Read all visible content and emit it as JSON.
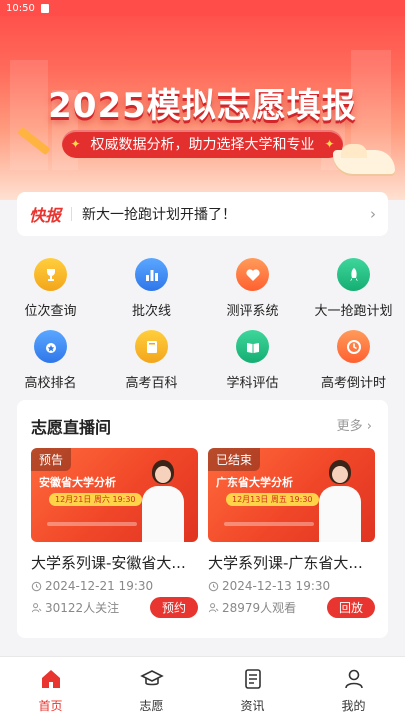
{
  "status_bar": {
    "time": "10:50"
  },
  "hero": {
    "title": "2025模拟志愿填报",
    "subtitle": "权威数据分析，助力选择大学和专业",
    "accent": "#ff4a48"
  },
  "news": {
    "tag": "快报",
    "text": "新大一抢跑计划开播了！"
  },
  "grid": [
    {
      "label": "位次查询",
      "icon": "trophy-icon",
      "color": "#f3a51a"
    },
    {
      "label": "批次线",
      "icon": "bar-chart-icon",
      "color": "#2f77ea"
    },
    {
      "label": "测评系统",
      "icon": "heart-icon",
      "color": "#ff6030"
    },
    {
      "label": "大一抢跑计划",
      "icon": "rocket-icon",
      "color": "#15ae72"
    },
    {
      "label": "高校排名",
      "icon": "medal-star-icon",
      "color": "#2f77ea"
    },
    {
      "label": "高考百科",
      "icon": "book-icon",
      "color": "#f3a51a"
    },
    {
      "label": "学科评估",
      "icon": "open-book-icon",
      "color": "#15ae72"
    },
    {
      "label": "高考倒计时",
      "icon": "clock-icon",
      "color": "#ff6030"
    }
  ],
  "live": {
    "title": "志愿直播间",
    "more": "更多",
    "cards": [
      {
        "badge": "预告",
        "thumb_title": "安徽省大学分析",
        "thumb_date": "12月21日 周六 19:30",
        "name": "大学系列课-安徽省大...",
        "time": "2024-12-21 19:30",
        "meta": "30122人关注",
        "action": "预约"
      },
      {
        "badge": "已结束",
        "thumb_title": "广东省大学分析",
        "thumb_date": "12月13日 周五 19:30",
        "name": "大学系列课-广东省大...",
        "time": "2024-12-13 19:30",
        "meta": "28979人观看",
        "action": "回放"
      }
    ]
  },
  "tabbar": [
    {
      "label": "首页",
      "icon": "home-icon",
      "active": true
    },
    {
      "label": "志愿",
      "icon": "graduation-cap-icon",
      "active": false
    },
    {
      "label": "资讯",
      "icon": "news-doc-icon",
      "active": false
    },
    {
      "label": "我的",
      "icon": "user-icon",
      "active": false
    }
  ],
  "colors": {
    "accent": "#e8352f",
    "text": "#222222",
    "muted": "#888888"
  }
}
